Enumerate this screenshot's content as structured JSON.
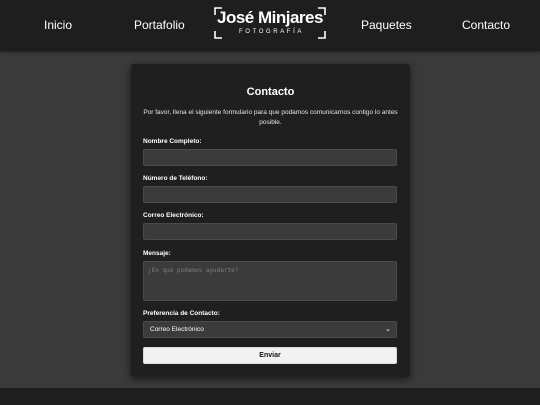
{
  "nav": {
    "items": [
      {
        "label": "Inicio"
      },
      {
        "label": "Portafolio"
      },
      {
        "label": "Paquetes"
      },
      {
        "label": "Contacto"
      }
    ],
    "logo": {
      "name": "José Minjares",
      "subtitle": "FOTOGRAFÍA"
    }
  },
  "form": {
    "title": "Contacto",
    "description": "Por favor, llena el siguiente formulario para que podamos comunicarnos contigo lo antes posible.",
    "fields": {
      "name": {
        "label": "Nombre Completo:",
        "value": ""
      },
      "phone": {
        "label": "Número de Teléfono:",
        "value": ""
      },
      "email": {
        "label": "Correo Electrónico:",
        "value": ""
      },
      "message": {
        "label": "Mensaje:",
        "placeholder": "¿En qué podemos ayudarte?"
      },
      "preference": {
        "label": "Preferencia de Contacto:",
        "selected": "Correo Electrónico"
      }
    },
    "submit_label": "Enviar"
  },
  "colors": {
    "page_background": "#3a3a3a",
    "navbar_background": "#1e1e1e",
    "card_background": "#1f1f1f",
    "input_background": "#3b3b3b",
    "button_background": "#f2f2f2"
  },
  "icons": {
    "select_arrow": "chevron-down-icon",
    "logo_frame": "frame-corners-icon"
  }
}
